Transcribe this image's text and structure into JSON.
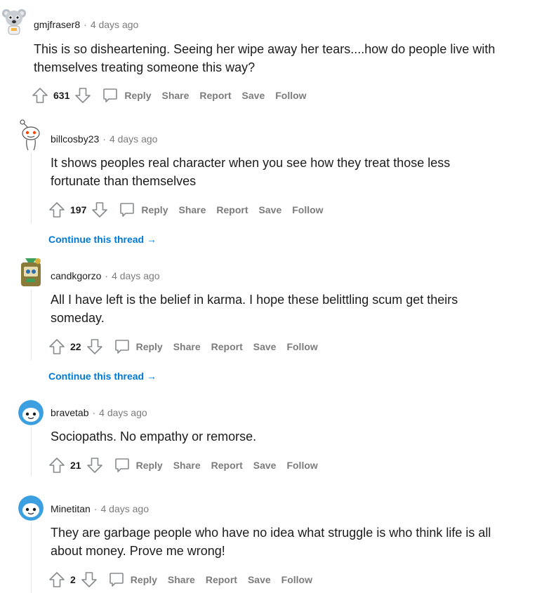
{
  "comments": [
    {
      "username": "gmjfraser8",
      "time": "4 days ago",
      "text": "This is so disheartening. Seeing her wipe away her tears....how do people live with themselves treating someone this way?",
      "score": "631"
    },
    {
      "username": "billcosby23",
      "time": "4 days ago",
      "text": "It shows peoples real character when you see how they treat those less fortunate than themselves",
      "score": "197"
    },
    {
      "username": "candkgorzo",
      "time": "4 days ago",
      "text": "All I have left is the belief in karma. I hope these belittling scum get theirs someday.",
      "score": "22"
    },
    {
      "username": "bravetab",
      "time": "4 days ago",
      "text": "Sociopaths. No empathy or remorse.",
      "score": "21"
    },
    {
      "username": "Minetitan",
      "time": "4 days ago",
      "text": "They are garbage people who have no idea what struggle is who think life is all about money. Prove me wrong!",
      "score": "2"
    }
  ],
  "actions": {
    "reply": "Reply",
    "share": "Share",
    "report": "Report",
    "save": "Save",
    "follow": "Follow"
  },
  "continue_thread": "Continue this thread →",
  "separator": "·",
  "colors": {
    "link": "#0079d3",
    "muted": "#7c7c7c",
    "text": "#1c1c1c",
    "snoo_blue": "#3ca0e0",
    "snoo_red": "#ff4500"
  }
}
